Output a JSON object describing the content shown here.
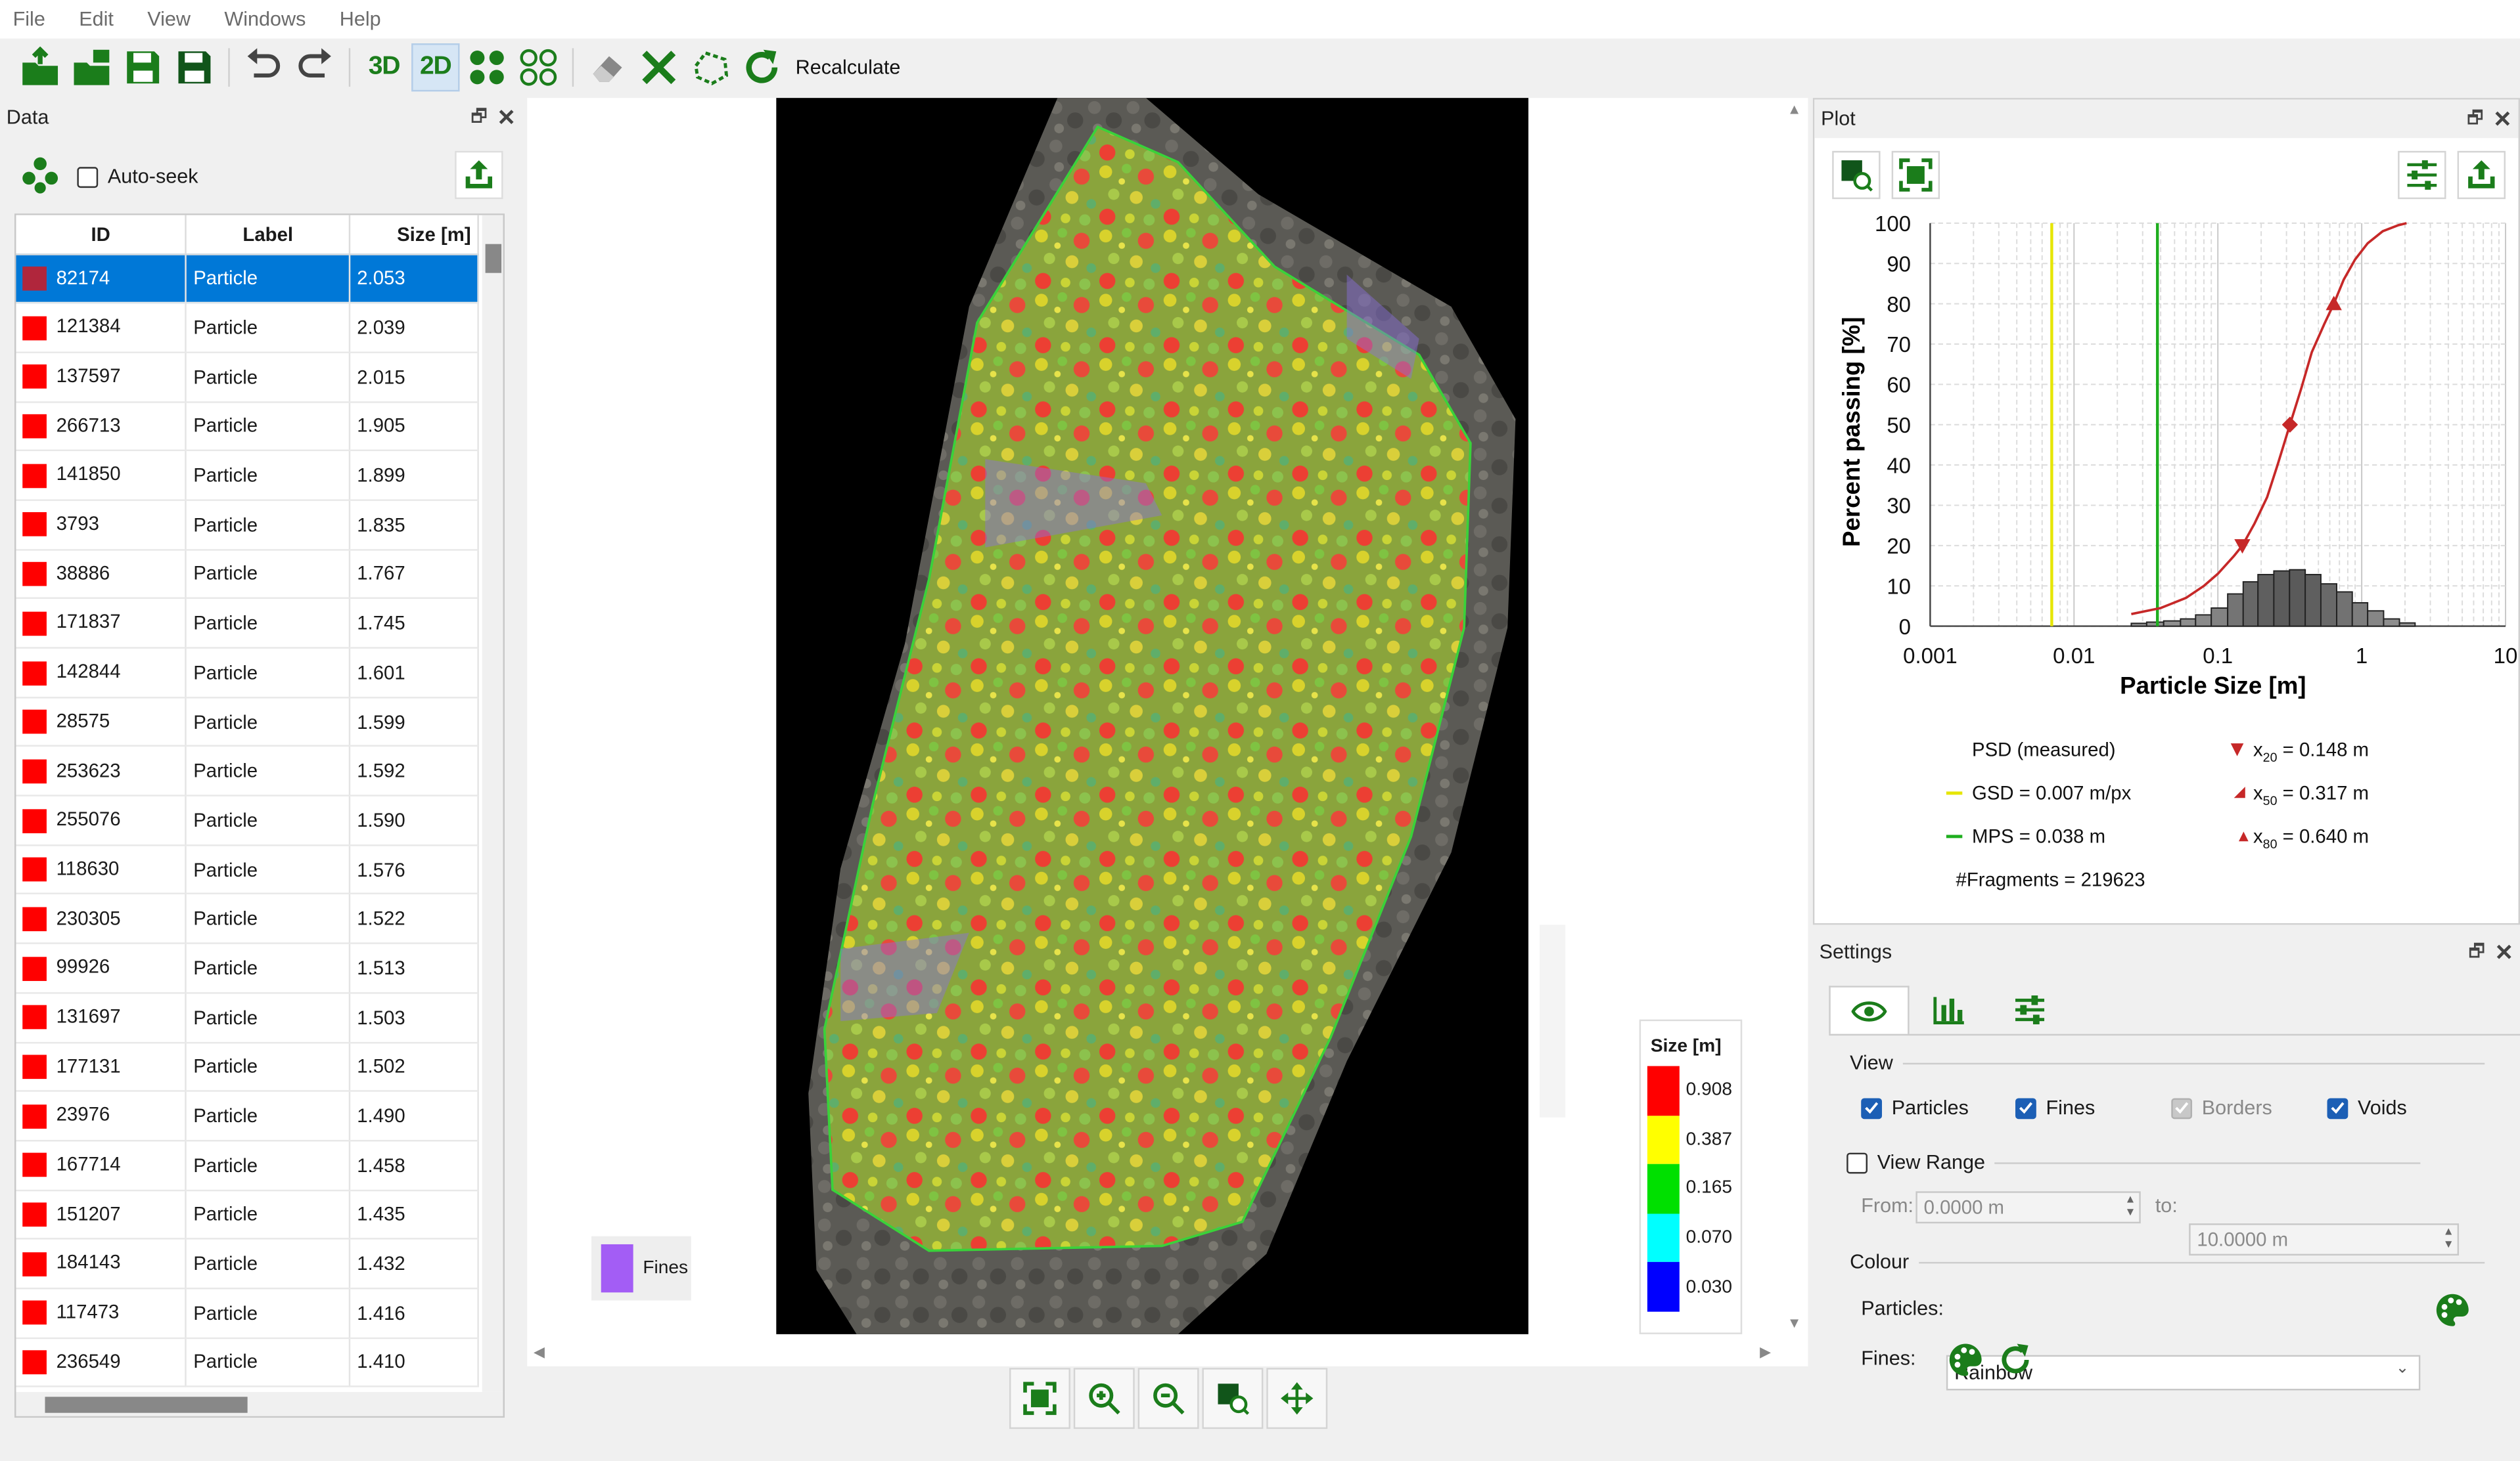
{
  "menu": [
    "File",
    "Edit",
    "View",
    "Windows",
    "Help"
  ],
  "toolbar": {
    "icons": [
      "open-project-icon",
      "import-icon",
      "save-icon",
      "save-as-icon",
      "undo-icon",
      "redo-icon",
      "3d-view",
      "2d-view",
      "particles-view-icon",
      "particle-outline-view-icon",
      "eraser-icon",
      "delete-icon",
      "lasso-icon",
      "recalculate-icon"
    ],
    "label_3d": "3D",
    "label_2d": "2D",
    "recalculate_label": "Recalculate"
  },
  "data_panel": {
    "title": "Data",
    "auto_seek_label": "Auto-seek",
    "columns": [
      "ID",
      "Label",
      "Size [m]"
    ],
    "rows": [
      {
        "id": "82174",
        "label": "Particle",
        "size": "2.053",
        "color": "#b0263c",
        "selected": true
      },
      {
        "id": "121384",
        "label": "Particle",
        "size": "2.039",
        "color": "#ff0000"
      },
      {
        "id": "137597",
        "label": "Particle",
        "size": "2.015",
        "color": "#ff0000"
      },
      {
        "id": "266713",
        "label": "Particle",
        "size": "1.905",
        "color": "#ff0000"
      },
      {
        "id": "141850",
        "label": "Particle",
        "size": "1.899",
        "color": "#ff0000"
      },
      {
        "id": "3793",
        "label": "Particle",
        "size": "1.835",
        "color": "#ff0000"
      },
      {
        "id": "38886",
        "label": "Particle",
        "size": "1.767",
        "color": "#ff0000"
      },
      {
        "id": "171837",
        "label": "Particle",
        "size": "1.745",
        "color": "#ff0000"
      },
      {
        "id": "142844",
        "label": "Particle",
        "size": "1.601",
        "color": "#ff0000"
      },
      {
        "id": "28575",
        "label": "Particle",
        "size": "1.599",
        "color": "#ff0000"
      },
      {
        "id": "253623",
        "label": "Particle",
        "size": "1.592",
        "color": "#ff0000"
      },
      {
        "id": "255076",
        "label": "Particle",
        "size": "1.590",
        "color": "#ff0000"
      },
      {
        "id": "118630",
        "label": "Particle",
        "size": "1.576",
        "color": "#ff0000"
      },
      {
        "id": "230305",
        "label": "Particle",
        "size": "1.522",
        "color": "#ff0000"
      },
      {
        "id": "99926",
        "label": "Particle",
        "size": "1.513",
        "color": "#ff0000"
      },
      {
        "id": "131697",
        "label": "Particle",
        "size": "1.503",
        "color": "#ff0000"
      },
      {
        "id": "177131",
        "label": "Particle",
        "size": "1.502",
        "color": "#ff0000"
      },
      {
        "id": "23976",
        "label": "Particle",
        "size": "1.490",
        "color": "#ff0000"
      },
      {
        "id": "167714",
        "label": "Particle",
        "size": "1.458",
        "color": "#ff0000"
      },
      {
        "id": "151207",
        "label": "Particle",
        "size": "1.435",
        "color": "#ff0000"
      },
      {
        "id": "184143",
        "label": "Particle",
        "size": "1.432",
        "color": "#ff0000"
      },
      {
        "id": "117473",
        "label": "Particle",
        "size": "1.416",
        "color": "#ff0000"
      },
      {
        "id": "236549",
        "label": "Particle",
        "size": "1.410",
        "color": "#ff0000"
      }
    ]
  },
  "viewer": {
    "fines_label": "Fines",
    "fines_color": "#a35df5",
    "legend_title": "Size [m]",
    "legend": [
      {
        "value": "0.908",
        "color": "#ff0000"
      },
      {
        "value": "0.387",
        "color": "#ffff00"
      },
      {
        "value": "0.165",
        "color": "#00e000"
      },
      {
        "value": "0.070",
        "color": "#00ffff"
      },
      {
        "value": "0.030",
        "color": "#0000ff"
      }
    ],
    "bottom_icons": [
      "fit-view-icon",
      "zoom-in-icon",
      "zoom-out-icon",
      "zoom-selection-icon",
      "pan-icon"
    ]
  },
  "plot_panel": {
    "title": "Plot",
    "ylabel": "Percent passing [%]",
    "xlabel": "Particle Size [m]",
    "yticks": [
      "100",
      "90",
      "80",
      "70",
      "60",
      "50",
      "40",
      "30",
      "20",
      "10",
      "0"
    ],
    "xticks": [
      "0.001",
      "0.01",
      "0.1",
      "1",
      "10"
    ],
    "legend": {
      "psd": "PSD (measured)",
      "gsd": "GSD = 0.007 m/px",
      "mps": "MPS = 0.038 m",
      "fragments": "#Fragments = 219623",
      "x20_sub": "20",
      "x20_val": "= 0.148 m",
      "x50_sub": "50",
      "x50_val": "= 0.317 m",
      "x80_sub": "80",
      "x80_val": "= 0.640 m",
      "x_letter": "x"
    },
    "colors": {
      "psd": "#c62828",
      "gsd": "#e6e600",
      "mps": "#1fae1f"
    }
  },
  "chart_data": {
    "type": "line",
    "xlabel": "Particle Size [m]",
    "ylabel": "Percent passing [%]",
    "xscale": "log",
    "xlim": [
      0.001,
      10
    ],
    "ylim": [
      0,
      100
    ],
    "grid": true,
    "series": [
      {
        "name": "PSD (measured)",
        "x": [
          0.025,
          0.04,
          0.06,
          0.08,
          0.1,
          0.13,
          0.148,
          0.18,
          0.22,
          0.26,
          0.317,
          0.38,
          0.45,
          0.55,
          0.64,
          0.75,
          0.9,
          1.1,
          1.4,
          1.8,
          2.05
        ],
        "y": [
          3,
          4.5,
          7,
          10,
          13,
          17.5,
          20,
          25.5,
          32,
          40,
          50,
          59,
          68,
          75,
          80,
          86,
          91,
          95,
          98,
          99.5,
          100
        ]
      }
    ],
    "histogram": {
      "edges": [
        0.025,
        0.032,
        0.042,
        0.055,
        0.07,
        0.09,
        0.117,
        0.15,
        0.19,
        0.245,
        0.315,
        0.405,
        0.52,
        0.67,
        0.86,
        1.1,
        1.42,
        1.83,
        2.35
      ],
      "heights": [
        0.7,
        1.0,
        1.3,
        1.8,
        2.8,
        4.5,
        8.0,
        11.0,
        12.8,
        13.7,
        14.0,
        12.8,
        10.5,
        8.5,
        5.8,
        3.8,
        1.8,
        0.8
      ]
    },
    "vlines": [
      {
        "name": "GSD",
        "x": 0.007
      },
      {
        "name": "MPS",
        "x": 0.038
      }
    ],
    "markers": [
      {
        "label": "x20",
        "x": 0.148,
        "y": 20
      },
      {
        "label": "x50",
        "x": 0.317,
        "y": 50
      },
      {
        "label": "x80",
        "x": 0.64,
        "y": 80
      }
    ]
  },
  "settings_panel": {
    "title": "Settings",
    "tabs": [
      "eye-icon",
      "histogram-icon",
      "sliders-icon"
    ],
    "view_label": "View",
    "particles_label": "Particles",
    "fines_label": "Fines",
    "borders_label": "Borders",
    "voids_label": "Voids",
    "view_range_label": "View Range",
    "from_label": "From:",
    "from_value": "0.0000 m",
    "to_label": "to:",
    "to_value": "10.0000 m",
    "colour_label": "Colour",
    "particles_colour_label": "Particles:",
    "particles_colour_value": "Rainbow",
    "fines_colour_label": "Fines:"
  }
}
